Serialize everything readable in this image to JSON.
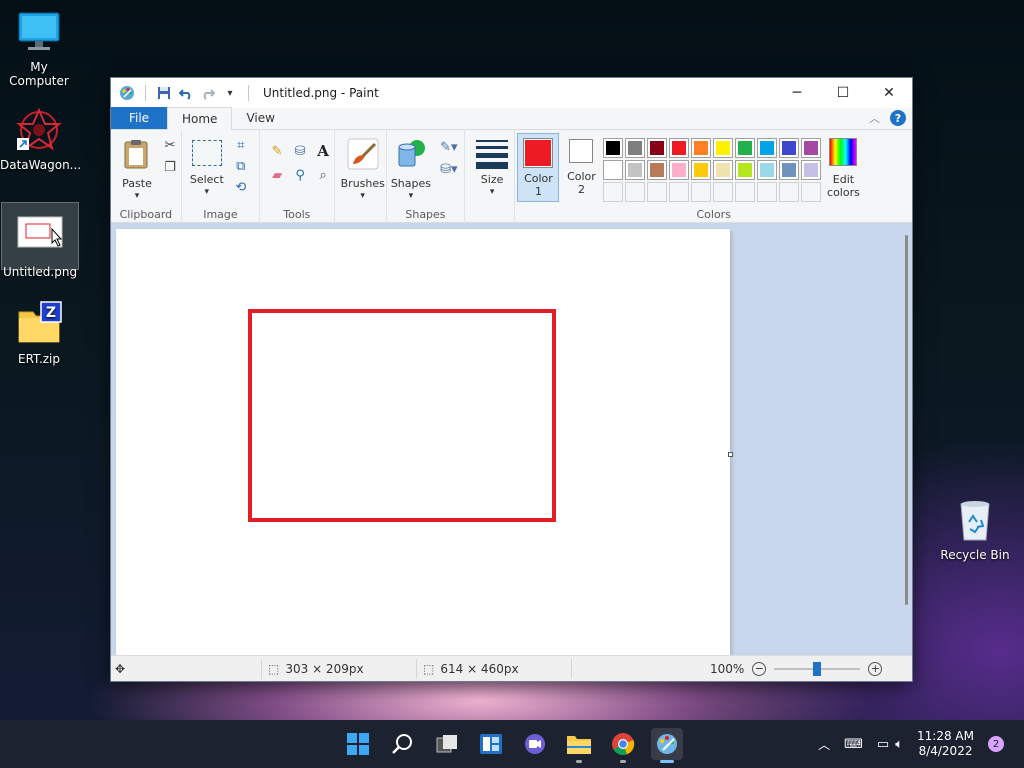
{
  "desktop": {
    "icons": [
      {
        "label": "My Computer"
      },
      {
        "label": "DataWagon..."
      },
      {
        "label": "Untitled.png"
      },
      {
        "label": "ERT.zip"
      },
      {
        "label": "Recycle Bin"
      }
    ]
  },
  "window": {
    "title": "Untitled.png - Paint",
    "tabs": [
      {
        "label": "File"
      },
      {
        "label": "Home"
      },
      {
        "label": "View"
      }
    ],
    "help_label": "?",
    "ribbon": {
      "clipboard": {
        "label": "Clipboard",
        "paste": "Paste"
      },
      "image": {
        "label": "Image",
        "select": "Select"
      },
      "tools": {
        "label": "Tools"
      },
      "brushes": {
        "label": "Brushes"
      },
      "shapes": {
        "label": "Shapes",
        "shapes_btn": "Shapes"
      },
      "size": {
        "label": "Size"
      },
      "colors": {
        "label": "Colors",
        "color1": "Color",
        "color1_num": "1",
        "color2": "Color",
        "color2_num": "2",
        "edit": "Edit",
        "edit2": "colors",
        "color1_value": "#ed1c24",
        "color2_value": "#ffffff",
        "row1": [
          "#000000",
          "#7f7f7f",
          "#880015",
          "#ed1c24",
          "#ff7f27",
          "#fff200",
          "#22b14c",
          "#00a2e8",
          "#3f48cc",
          "#a349a4"
        ],
        "row2": [
          "#ffffff",
          "#c3c3c3",
          "#b97a57",
          "#ffaec9",
          "#ffc90e",
          "#efe4b0",
          "#b5e61d",
          "#99d9ea",
          "#7092be",
          "#c8bfe7"
        ]
      }
    },
    "canvas": {
      "shape_color": "#e41e26"
    },
    "status": {
      "selection_size": "303 × 209px",
      "image_size": "614 × 460px",
      "zoom": "100%",
      "zoom_level": 0.5
    }
  },
  "taskbar": {
    "time": "11:28 AM",
    "date": "8/4/2022",
    "notifications": "2"
  }
}
